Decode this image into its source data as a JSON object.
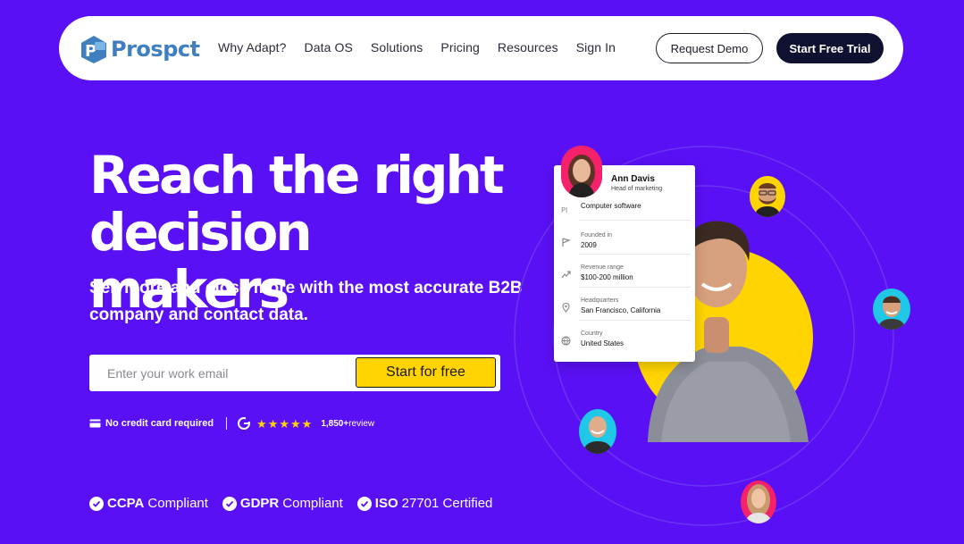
{
  "brand": {
    "name": "Prospct",
    "color": "#3f7fbf"
  },
  "nav": {
    "items": [
      {
        "label": "Why Adapt?"
      },
      {
        "label": "Data OS"
      },
      {
        "label": "Solutions"
      },
      {
        "label": "Pricing"
      },
      {
        "label": "Resources"
      },
      {
        "label": "Sign In"
      }
    ],
    "request_demo": "Request Demo",
    "start_trial": "Start Free Trial"
  },
  "hero": {
    "title_line1": "Reach the right",
    "title_line2": "decision makers",
    "subtitle_line1": "Sell more and close more with the most accurate B2B",
    "subtitle_line2": "company and contact data.",
    "email_placeholder": "Enter your work email",
    "cta": "Start for free"
  },
  "trust": {
    "no_card": "No credit card required",
    "rating_stars": 5,
    "review_count": "1,850+",
    "review_word": "review"
  },
  "compliance": [
    {
      "strong": "CCPA",
      "rest": "Compliant"
    },
    {
      "strong": "GDPR",
      "rest": "Compliant"
    },
    {
      "strong": "ISO",
      "rest": "27701 Certified"
    }
  ],
  "profile_card": {
    "name": "Ann Davis",
    "role": "Head of marketing",
    "rows": [
      {
        "icon": "industry-icon",
        "label": "",
        "value": "Computer software"
      },
      {
        "icon": "flag-icon",
        "label": "Founded in",
        "value": "2009"
      },
      {
        "icon": "trend-icon",
        "label": "Revenue range",
        "value": "$100-200 million"
      },
      {
        "icon": "location-pin-icon",
        "label": "Headquarters",
        "value": "San Francisco, California"
      },
      {
        "icon": "globe-icon",
        "label": "Country",
        "value": "United States"
      }
    ]
  },
  "colors": {
    "background": "#5a10f5",
    "accent_yellow": "#ffd400",
    "dark_button": "#0f1130",
    "orbit_line": "#6a35f0"
  }
}
